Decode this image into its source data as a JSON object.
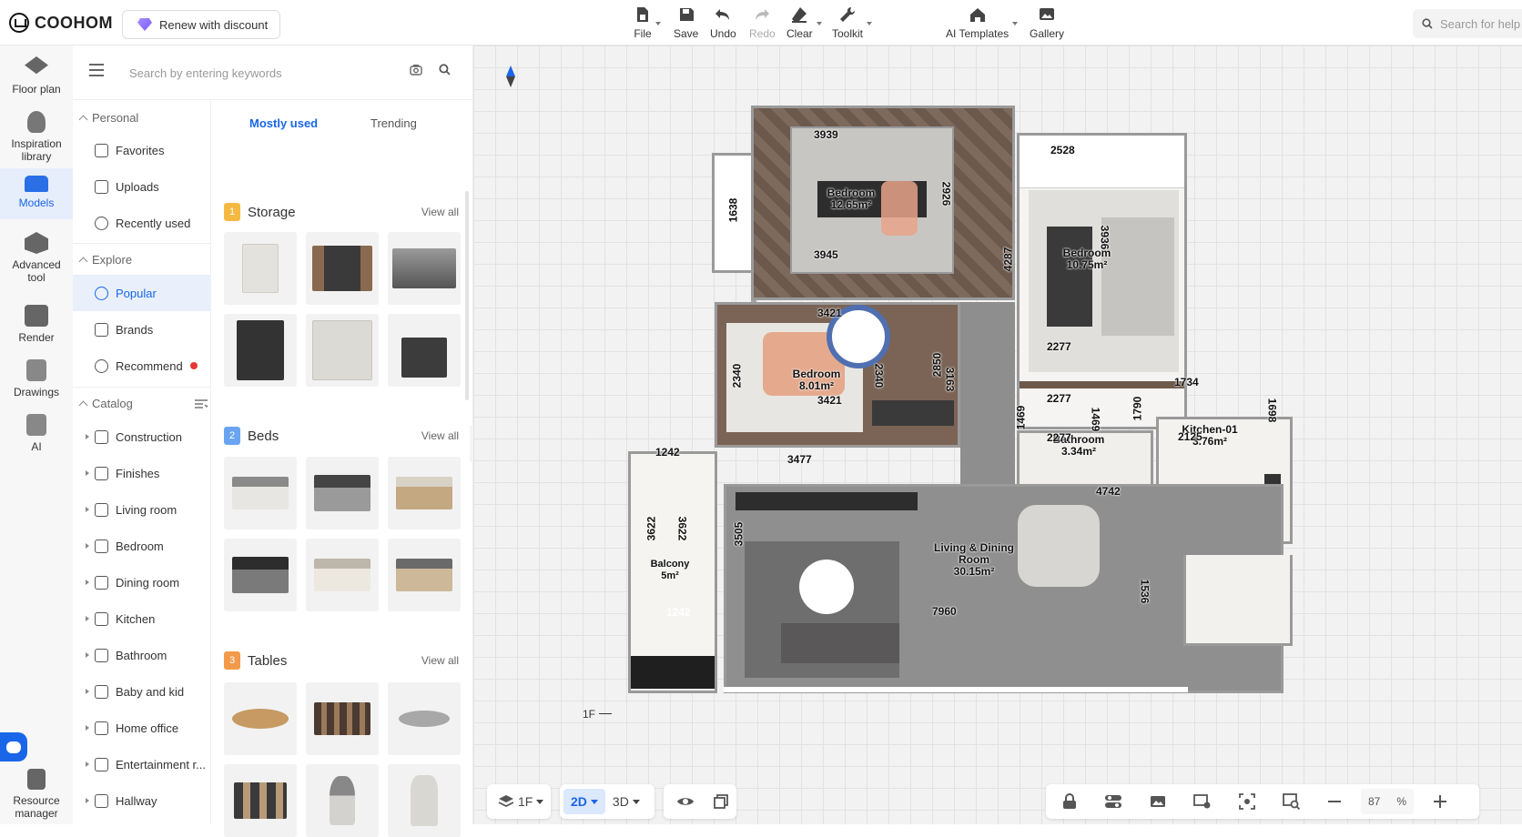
{
  "brand": {
    "name": "COOHOM",
    "renew_label": "Renew with discount"
  },
  "toolbar": [
    {
      "label": "File",
      "icon": "file-icon",
      "disabled": false,
      "dropdown": true
    },
    {
      "label": "Save",
      "icon": "save-icon",
      "disabled": false,
      "dropdown": false
    },
    {
      "label": "Undo",
      "icon": "undo-icon",
      "disabled": false,
      "dropdown": false
    },
    {
      "label": "Redo",
      "icon": "redo-icon",
      "disabled": true,
      "dropdown": false
    },
    {
      "label": "Clear",
      "icon": "eraser-icon",
      "disabled": false,
      "dropdown": true
    },
    {
      "label": "Toolkit",
      "icon": "wrench-icon",
      "disabled": false,
      "dropdown": true
    },
    {
      "label": "AI Templates",
      "icon": "ai-house-icon",
      "disabled": false,
      "dropdown": true
    },
    {
      "label": "Gallery",
      "icon": "gallery-icon",
      "disabled": false,
      "dropdown": false
    }
  ],
  "help_search": {
    "placeholder": "Search for help"
  },
  "rail": [
    {
      "label": "Floor plan",
      "icon": "floor-plan-icon",
      "active": false
    },
    {
      "label": "Inspiration library",
      "icon": "bulb-icon",
      "active": false
    },
    {
      "label": "Models",
      "icon": "sofa-icon",
      "active": true
    },
    {
      "label": "Advanced tool",
      "icon": "advanced-tool-icon",
      "active": false
    },
    {
      "label": "Render",
      "icon": "camera-icon",
      "active": false
    },
    {
      "label": "Drawings",
      "icon": "drawings-icon",
      "active": false
    },
    {
      "label": "AI",
      "icon": "ai-icon",
      "active": false
    },
    {
      "label": "Resource manager",
      "icon": "resource-manager-icon",
      "active": false
    }
  ],
  "panel": {
    "search_placeholder": "Search by entering keywords",
    "personal_heading": "Personal",
    "personal": [
      {
        "label": "Favorites",
        "icon": "star-icon"
      },
      {
        "label": "Uploads",
        "icon": "upload-icon"
      },
      {
        "label": "Recently used",
        "icon": "clock-icon"
      }
    ],
    "explore_heading": "Explore",
    "explore": [
      {
        "label": "Popular",
        "icon": "flame-icon",
        "active": true
      },
      {
        "label": "Brands",
        "icon": "brand-icon",
        "active": false
      },
      {
        "label": "Recommend",
        "icon": "recommend-icon",
        "active": false,
        "badge": true
      }
    ],
    "catalog_heading": "Catalog",
    "catalog": [
      {
        "label": "Construction",
        "icon": "construction-icon"
      },
      {
        "label": "Finishes",
        "icon": "finishes-icon"
      },
      {
        "label": "Living room",
        "icon": "sofa-icon"
      },
      {
        "label": "Bedroom",
        "icon": "bed-icon"
      },
      {
        "label": "Dining room",
        "icon": "dining-icon"
      },
      {
        "label": "Kitchen",
        "icon": "kitchen-icon"
      },
      {
        "label": "Bathroom",
        "icon": "bathtub-icon"
      },
      {
        "label": "Baby and kid",
        "icon": "baby-icon"
      },
      {
        "label": "Home office",
        "icon": "desk-icon"
      },
      {
        "label": "Entertainment r...",
        "icon": "entertainment-icon"
      },
      {
        "label": "Hallway",
        "icon": "hallway-icon"
      }
    ],
    "tabs": [
      {
        "label": "Mostly used",
        "active": true
      },
      {
        "label": "Trending",
        "active": false
      }
    ],
    "groups": [
      {
        "index": "1",
        "title": "Storage",
        "view_all": "View all",
        "color": "#f5b942"
      },
      {
        "index": "2",
        "title": "Beds",
        "view_all": "View all",
        "color": "#6aa4f0"
      },
      {
        "index": "3",
        "title": "Tables",
        "view_all": "View all",
        "color": "#f29a4a"
      }
    ]
  },
  "floorplan": {
    "rooms": [
      {
        "name": "Bedroom",
        "area": "12.65m²"
      },
      {
        "name": "Bedroom",
        "area": "10.75m²"
      },
      {
        "name": "Bedroom",
        "area": "8.01m²"
      },
      {
        "name": "Bathroom",
        "area": "3.34m²"
      },
      {
        "name": "Kitchen-01",
        "area": "3.76m²"
      },
      {
        "name": "Living & Dining Room",
        "area": "30.15m²"
      },
      {
        "name": "Balcony",
        "area": "5m²"
      }
    ],
    "dimensions": [
      "3939",
      "3945",
      "1638",
      "2926",
      "2528",
      "4287",
      "3936",
      "2277",
      "3421",
      "3421",
      "2340",
      "2340",
      "2850",
      "3163",
      "2277",
      "2277",
      "1469",
      "1469",
      "1790",
      "1734",
      "2125",
      "1698",
      "3477",
      "4742",
      "3505",
      "7960",
      "1536",
      "1242",
      "1242",
      "3622",
      "3622"
    ],
    "floor_marker": "1F"
  },
  "bottombar": {
    "floor": "1F",
    "view2d": "2D",
    "view3d": "3D",
    "zoom": "87",
    "zoom_unit": "%"
  }
}
